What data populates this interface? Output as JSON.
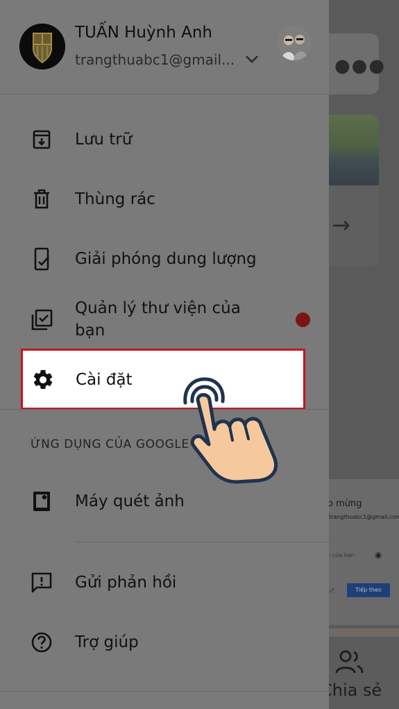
{
  "background": {
    "more_icon": "more-horiz-icon",
    "arrow_icon": "arrow-forward-icon",
    "login": {
      "title": "o mừng",
      "email": "trangthuabc1@gmail.com",
      "password_placeholder": "ı của bạn",
      "question": "u?",
      "next_button": "Tiếp theo"
    },
    "bottom_nav": {
      "share_label": "Chia sẻ",
      "share_icon": "people-icon"
    }
  },
  "drawer": {
    "account": {
      "name": "TUẤN Huỳnh Anh",
      "email": "trangthuabc1@gmail...",
      "avatar": "fc-barcelona-crest",
      "switch_icon": "chevron-down-icon"
    },
    "menu": [
      {
        "label": "Lưu trữ",
        "icon": "archive-icon"
      },
      {
        "label": "Thùng rác",
        "icon": "trash-icon"
      },
      {
        "label": "Giải phóng dung lượng",
        "icon": "phone-check-icon"
      },
      {
        "label": "Quản lý thư viện của bạn",
        "icon": "library-check-icon",
        "badge": true
      },
      {
        "label": "Cài đặt",
        "icon": "gear-icon",
        "highlighted": true
      }
    ],
    "section_header": "ỨNG DỤNG CỦA GOOGLE",
    "apps": [
      {
        "label": "Máy quét ảnh",
        "icon": "photo-scanner-icon"
      }
    ],
    "footer_menu": [
      {
        "label": "Gửi phản hồi",
        "icon": "feedback-icon"
      },
      {
        "label": "Trợ giúp",
        "icon": "help-icon"
      }
    ]
  },
  "colors": {
    "highlight_border": "#c8131c",
    "badge": "#7d1414",
    "scrim_drawer": "#7a7a7a",
    "hand_skin": "#f5c99c",
    "hand_outline": "#1f3350"
  }
}
